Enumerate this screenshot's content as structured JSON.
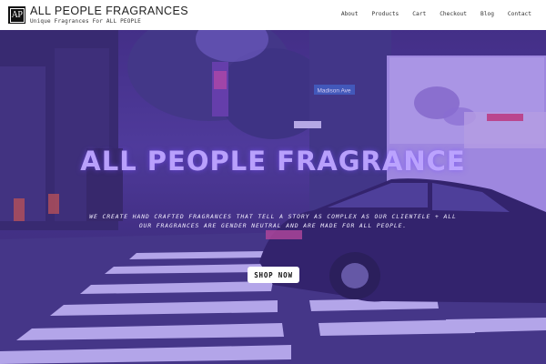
{
  "site": {
    "logo_text": "AP",
    "title": "ALL PEOPLE FRAGRANCES",
    "tagline": "Unique Fragrances For ALL PEOPLE"
  },
  "nav": {
    "items": [
      {
        "label": "About"
      },
      {
        "label": "Products"
      },
      {
        "label": "Cart"
      },
      {
        "label": "Checkout"
      },
      {
        "label": "Blog"
      },
      {
        "label": "Contact"
      }
    ]
  },
  "hero": {
    "title": "ALL PEOPLE FRAGRANCE",
    "text": "WE CREATE HAND CRAFTED FRAGRANCES THAT TELL A STORY AS COMPLEX AS OUR CLIENTELE + ALL OUR FRAGRANCES ARE GENDER NEUTRAL AND ARE MADE FOR ALL PEOPLE.",
    "button_label": "SHOP NOW",
    "street_sign": "Madison Ave"
  },
  "colors": {
    "overlay": "#5a3cc8",
    "title_color": "#bea5ff"
  }
}
